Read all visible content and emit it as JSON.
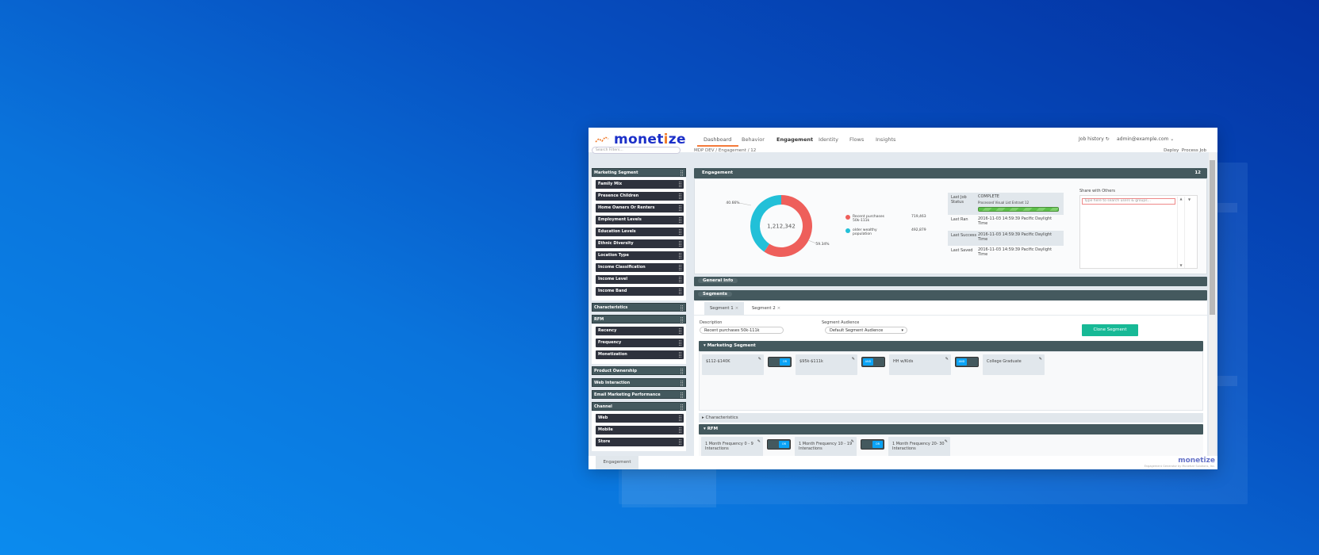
{
  "app": {
    "logo": "monetize",
    "logo_icon": "chart-line-icon"
  },
  "nav": [
    {
      "label": "Dashboard"
    },
    {
      "label": "Behavior"
    },
    {
      "label": "Engagement"
    },
    {
      "label": "Identity"
    },
    {
      "label": "Flows"
    },
    {
      "label": "Insights"
    }
  ],
  "header": {
    "job_history": "Job history",
    "job_history_icon": "refresh-icon",
    "user": "admin@example.com"
  },
  "sidebar": {
    "search_placeholder": "Search Filters...",
    "groups": [
      {
        "label": "Marketing Segment",
        "items": [
          "Family Mix",
          "Presence Children",
          "Home Owners Or Renters",
          "Employment Levels",
          "Education Levels",
          "Ethnic Diversity",
          "Location Type",
          "Income Classification",
          "Income Level",
          "Income Band"
        ]
      },
      {
        "label": "Characteristics",
        "items": []
      },
      {
        "label": "RFM",
        "items": [
          "Recency",
          "Frequency",
          "Monetization"
        ]
      },
      {
        "label": "Product Ownership",
        "items": []
      },
      {
        "label": "Web Interaction",
        "items": []
      },
      {
        "label": "Email Marketing Performance",
        "items": []
      },
      {
        "label": "Channel",
        "items": [
          "Web",
          "Mobile",
          "Store"
        ]
      }
    ]
  },
  "breadcrumb": {
    "text": "MDP DEV  /  Engagement  /  12",
    "deploy": "Deploy",
    "process": "Process Job"
  },
  "engagement": {
    "title": "Engagement",
    "id": "12",
    "donut": {
      "total": "1,212,342",
      "pct_a": "59.34%",
      "pct_b": "40.66%",
      "color_a": "#ee5f5b",
      "color_b": "#22c0d8"
    },
    "legend": [
      {
        "label": "Recent purchases 50k-111k",
        "value": "719,463"
      },
      {
        "label": "older wealthy population",
        "value": "492,879"
      }
    ],
    "status": [
      {
        "key": "Last Job Status",
        "value": "COMPLETE",
        "sub": "Processed Visual List Entrant 12",
        "progress": 100
      },
      {
        "key": "Last Ran",
        "value": "2016-11-03 14:59:39 Pacific Daylight Time"
      },
      {
        "key": "Last Success",
        "value": "2016-11-03 14:59:39 Pacific Daylight Time"
      },
      {
        "key": "Last Saved",
        "value": "2016-11-03 14:59:39 Pacific Daylight Time"
      }
    ],
    "share_label": "Share with Others",
    "share_placeholder": "Type here to search users & groups..."
  },
  "general_info": "General Info",
  "segments": {
    "title": "Segments",
    "tabs": [
      "Segment 1",
      "Segment 2"
    ],
    "description_label": "Description",
    "description_value": "Recent purchases 50k-111k",
    "audience_label": "Segment Audience",
    "audience_value": "Default Segment Audience",
    "clone": "Clone Segment",
    "marketing_title": "Marketing Segment",
    "marketing_cards": [
      "$112-$140K",
      "$95k-$111k",
      "HH w/Kids",
      "College Graduate"
    ],
    "marketing_ops": [
      "OR",
      "AND",
      "AND"
    ],
    "characteristics": "Characteristics",
    "rfm_title": "RFM",
    "rfm_cards": [
      "1 Month Frequency 0 - 9 Interactions",
      "1 Month Frequency 10 - 19 Interactions",
      "1 Month Frequency 20- 30 Interactions"
    ],
    "rfm_ops": [
      "OR",
      "OR"
    ]
  },
  "footer": {
    "tab": "Engagement",
    "brand": "monetize",
    "credit": "Engagement Generator by Monetize Solutions, Inc."
  }
}
